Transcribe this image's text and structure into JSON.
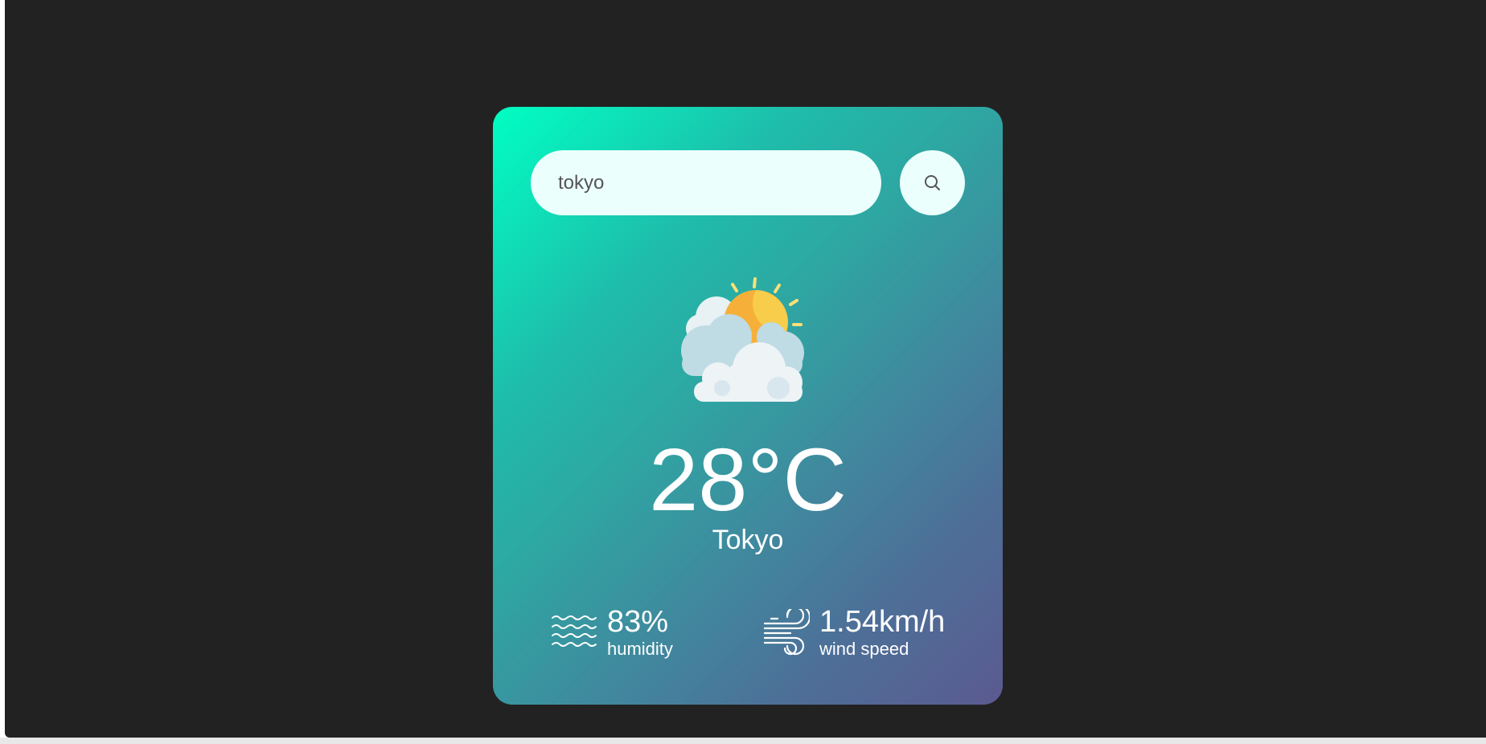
{
  "search": {
    "value": "tokyo",
    "placeholder": ""
  },
  "weather": {
    "icon": "sun-behind-clouds-icon",
    "temperature": "28°C",
    "city": "Tokyo"
  },
  "details": {
    "humidity": {
      "icon": "humidity-waves-icon",
      "value": "83%",
      "label": "humidity"
    },
    "wind": {
      "icon": "wind-icon",
      "value": "1.54km/h",
      "label": "wind speed"
    }
  },
  "colors": {
    "page_background": "#222222",
    "card_gradient_start": "#00ffc3",
    "card_gradient_end": "#5b5a90",
    "input_background": "#ebfffc",
    "text": "#ffffff"
  }
}
